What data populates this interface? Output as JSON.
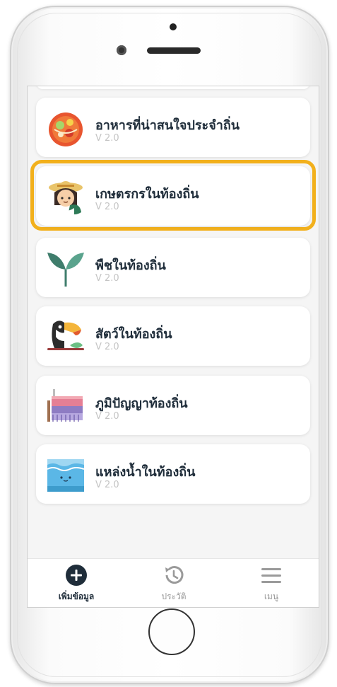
{
  "list": {
    "items": [
      {
        "title": "อาหารที่น่าสนใจประจำถิ่น",
        "version": "V 2.0",
        "icon": "food-bowl-icon"
      },
      {
        "title": "เกษตรกรในท้องถิ่น",
        "version": "V 2.0",
        "icon": "farmer-icon",
        "highlighted": true
      },
      {
        "title": "พืชในท้องถิ่น",
        "version": "V 2.0",
        "icon": "plant-sprout-icon"
      },
      {
        "title": "สัตว์ในท้องถิ่น",
        "version": "V 2.0",
        "icon": "toucan-icon"
      },
      {
        "title": "ภูมิปัญญาท้องถิ่น",
        "version": "V 2.0",
        "icon": "loom-weaving-icon"
      },
      {
        "title": "แหล่งน้ำในท้องถิ่น",
        "version": "V 2.0",
        "icon": "water-icon"
      }
    ]
  },
  "tabbar": {
    "add": {
      "label": "เพิ่มข้อมูล",
      "icon": "plus-circle-icon",
      "active": true
    },
    "history": {
      "label": "ประวัติ",
      "icon": "history-icon"
    },
    "menu": {
      "label": "เมนู",
      "icon": "hamburger-menu-icon"
    }
  },
  "colors": {
    "highlight": "#f2b01c",
    "title_text": "#1f2d3a",
    "version_text": "#c4c4c4",
    "tab_active": "#1f2d3a",
    "tab_inactive": "#9a9a9a"
  }
}
